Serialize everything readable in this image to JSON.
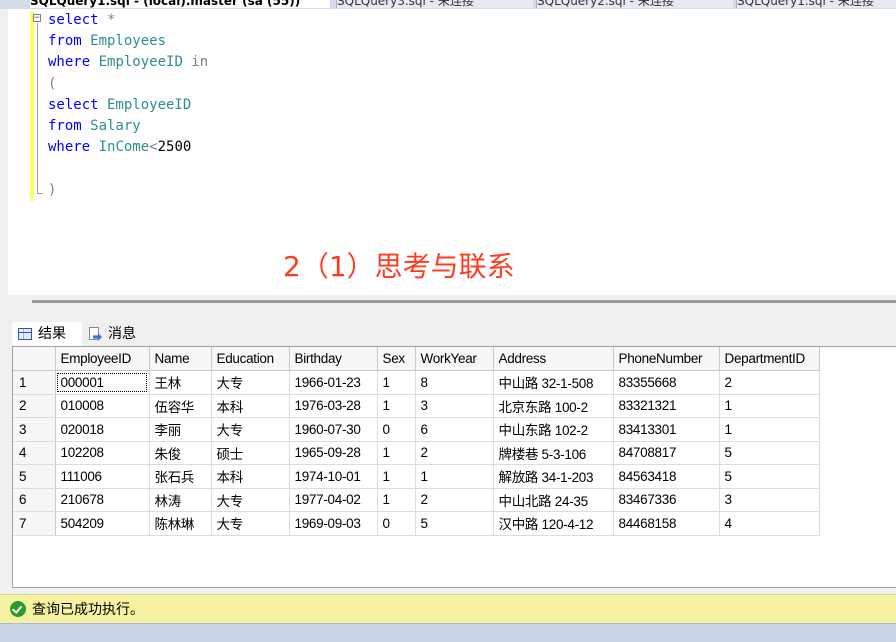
{
  "tabs": [
    {
      "label": "SQLQuery1.sql - (local).master (sa (55))",
      "active": true
    },
    {
      "label": "SQLQuery3.sql - 未连接",
      "active": false
    },
    {
      "label": "SQLQuery2.sql - 未连接",
      "active": false
    },
    {
      "label": "SQLQuery1.sql - 未连接",
      "active": false
    }
  ],
  "editor": {
    "lines": [
      [
        {
          "t": "select",
          "c": "kw"
        },
        {
          "t": " *",
          "c": "op"
        }
      ],
      [
        {
          "t": "from",
          "c": "kw"
        },
        {
          "t": " Employees",
          "c": "id"
        }
      ],
      [
        {
          "t": "where",
          "c": "kw"
        },
        {
          "t": " EmployeeID",
          "c": "id"
        },
        {
          "t": " in",
          "c": "op"
        }
      ],
      [
        {
          "t": "(",
          "c": "op"
        }
      ],
      [
        {
          "t": "select",
          "c": "kw"
        },
        {
          "t": " EmployeeID",
          "c": "id"
        }
      ],
      [
        {
          "t": "from",
          "c": "kw"
        },
        {
          "t": " Salary",
          "c": "id"
        }
      ],
      [
        {
          "t": "where",
          "c": "kw"
        },
        {
          "t": " InCome",
          "c": "id"
        },
        {
          "t": "<",
          "c": "op"
        },
        {
          "t": "2500",
          "c": "num"
        }
      ],
      [],
      [
        {
          "t": ")",
          "c": "op"
        }
      ]
    ],
    "annotation": "2（1）思考与联系"
  },
  "results_tabs": {
    "results_label": "结果",
    "messages_label": "消息"
  },
  "grid": {
    "columns": [
      "EmployeeID",
      "Name",
      "Education",
      "Birthday",
      "Sex",
      "WorkYear",
      "Address",
      "PhoneNumber",
      "DepartmentID"
    ],
    "rows": [
      [
        "1",
        "000001",
        "王林",
        "大专",
        "1966-01-23",
        "1",
        "8",
        "中山路 32-1-508",
        "83355668",
        "2"
      ],
      [
        "2",
        "010008",
        "伍容华",
        "本科",
        "1976-03-28",
        "1",
        "3",
        "北京东路 100-2",
        "83321321",
        "1"
      ],
      [
        "3",
        "020018",
        "李丽",
        "大专",
        "1960-07-30",
        "0",
        "6",
        "中山东路 102-2",
        "83413301",
        "1"
      ],
      [
        "4",
        "102208",
        "朱俊",
        "硕士",
        "1965-09-28",
        "1",
        "2",
        "牌楼巷 5-3-106",
        "84708817",
        "5"
      ],
      [
        "5",
        "111006",
        "张石兵",
        "本科",
        "1974-10-01",
        "1",
        "1",
        "解放路 34-1-203",
        "84563418",
        "5"
      ],
      [
        "6",
        "210678",
        "林涛",
        "大专",
        "1977-04-02",
        "1",
        "2",
        "中山北路 24-35",
        "83467336",
        "3"
      ],
      [
        "7",
        "504209",
        "陈林琳",
        "大专",
        "1969-09-03",
        "0",
        "5",
        "汉中路 120-4-12",
        "84468158",
        "4"
      ]
    ]
  },
  "status": {
    "message": "查询已成功执行。"
  }
}
